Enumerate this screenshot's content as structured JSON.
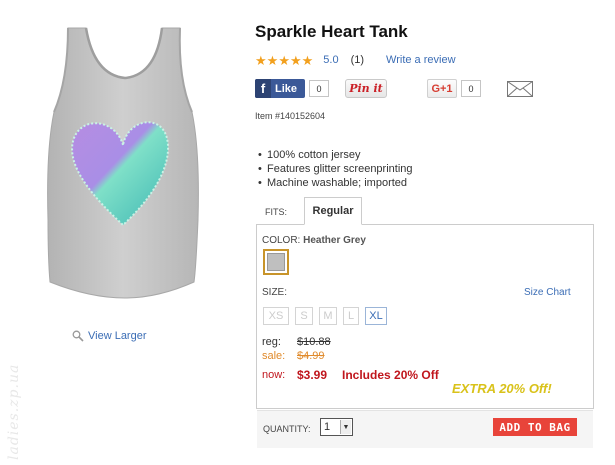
{
  "product": {
    "title": "Sparkle Heart Tank",
    "rating_value": "5.0",
    "rating_count": "(1)",
    "stars": 5,
    "write_review": "Write a review",
    "item_number": "Item #140152604",
    "view_larger": "View Larger",
    "features": [
      "100% cotton jersey",
      "Features glitter screenprinting",
      "Machine washable; imported"
    ]
  },
  "social": {
    "fb_like_label": "Like",
    "fb_count": "0",
    "pinit_label": "Pin it",
    "gplus_label": "G+1",
    "gplus_count": "0"
  },
  "fits": {
    "label": "FITS:",
    "selected_tab": "Regular"
  },
  "color": {
    "label": "COLOR:",
    "value": "Heather Grey",
    "swatch_hex": "#bfbfbf"
  },
  "size": {
    "label": "SIZE:",
    "chart_link": "Size Chart",
    "options": [
      {
        "label": "XS",
        "available": false
      },
      {
        "label": "S",
        "available": false
      },
      {
        "label": "M",
        "available": false
      },
      {
        "label": "L",
        "available": false
      },
      {
        "label": "XL",
        "available": true
      }
    ]
  },
  "pricing": {
    "reg_label": "reg:",
    "reg_value": "$10.88",
    "sale_label": "sale:",
    "sale_value": "$4.99",
    "now_label": "now:",
    "now_value": "$3.99",
    "now_promo": "Includes 20% Off",
    "extra_banner": "EXTRA 20% Off!"
  },
  "cart": {
    "quantity_label": "QUANTITY:",
    "quantity_value": "1",
    "add_button": "ADD TO BAG"
  },
  "watermark": "ladies.zp.ua",
  "colors": {
    "link": "#3b6db5",
    "price_red": "#c0161d",
    "sale_orange": "#e08a2b",
    "star": "#f2a01e",
    "add_button": "#e8443a",
    "extra_yellow": "#d9c21a",
    "shirt": "#c8c8c8",
    "heart_purple": "#b48be0",
    "heart_teal": "#5fd6c0"
  }
}
